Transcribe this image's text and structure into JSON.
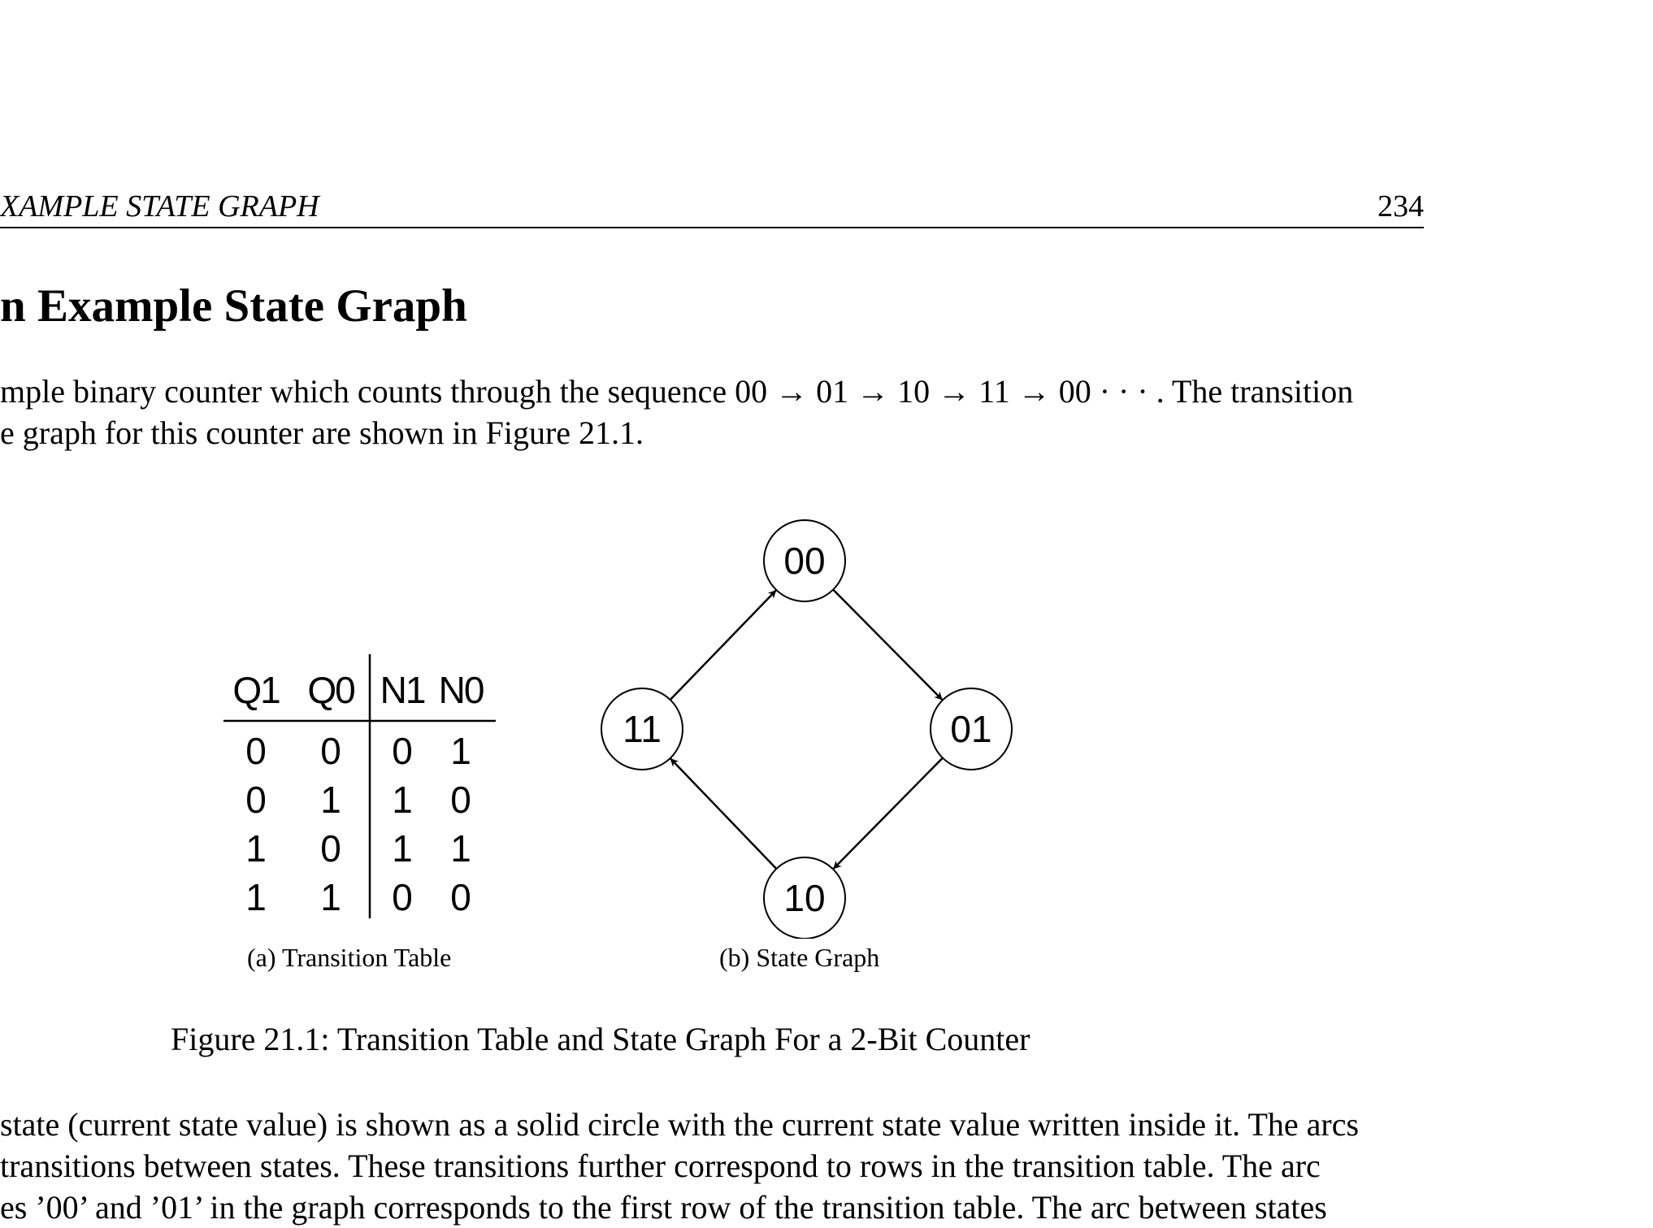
{
  "header": {
    "title": "XAMPLE STATE GRAPH",
    "page_number": "234"
  },
  "section_title": "n Example State Graph",
  "intro": {
    "line1": "mple binary counter which counts through the sequence 00 → 01 → 10 → 11 → 00 · · · . The transition",
    "line2": "e graph for this counter are shown in Figure 21.1."
  },
  "figure": {
    "table": {
      "headers": [
        "Q1",
        "Q0",
        "N1",
        "N0"
      ],
      "rows": [
        [
          "0",
          "0",
          "0",
          "1"
        ],
        [
          "0",
          "1",
          "1",
          "0"
        ],
        [
          "1",
          "0",
          "1",
          "1"
        ],
        [
          "1",
          "1",
          "0",
          "0"
        ]
      ],
      "caption": "(a)  Transition Table"
    },
    "graph": {
      "states": [
        "00",
        "01",
        "10",
        "11"
      ],
      "transitions": [
        [
          "00",
          "01"
        ],
        [
          "01",
          "10"
        ],
        [
          "10",
          "11"
        ],
        [
          "11",
          "00"
        ]
      ],
      "caption": "(b)  State Graph"
    },
    "caption": "Figure 21.1: Transition Table and State Graph For a 2-Bit Counter"
  },
  "body": {
    "line1": " state (current state value) is shown as a solid circle with the current state value written inside it. The arcs",
    "line2": " transitions between states. These transitions further correspond to rows in the transition table. The arc",
    "line3": "es ’00’ and ’01’ in the graph corresponds to the first row of the transition table. The arc between states"
  }
}
